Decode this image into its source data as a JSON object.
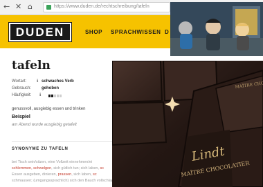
{
  "browser": {
    "url": "https://www.duden.de/rechtschreibung/tafeln",
    "back_icon": "arrow-left-icon",
    "close_icon": "close-icon",
    "home_icon": "home-icon",
    "lock_icon": "lock-icon"
  },
  "header": {
    "logo": "DUDEN",
    "nav": [
      "SHOP",
      "SPRACHWISSEN",
      "D"
    ],
    "brand_color": "#f6c200"
  },
  "entry": {
    "title": "tafeln",
    "wortart_label": "Wortart:",
    "wortart_value": "schwaches Verb",
    "gebrauch_label": "Gebrauch:",
    "gebrauch_value": "gehoben",
    "haeufigkeit_label": "Häufigkeit:",
    "frequency": 2,
    "frequency_max": 5,
    "definition": "genussvoll, ausgiebig essen und trinken",
    "beispiel_label": "Beispiel",
    "beispiel": "am Abend wurde ausgiebig getafelt"
  },
  "synonyms": {
    "title": "SYNONYME ZU TAFELN",
    "lines": [
      {
        "pre": "bei Tisch sein/sitzen, eine Vollzeit einnehmen/ei",
        "red": "",
        "post": ""
      },
      {
        "pre": "",
        "red": "schlemmen, schwelgen",
        "post": ", sich gütlich tun; sich laben, ",
        "red2": "sc"
      },
      {
        "pre": "Essen ausgeben, dinieren, ",
        "red": "prassen",
        "post": ", sich laben, ",
        "red2": "sc"
      },
      {
        "pre": "schmausen; ",
        "red": "",
        "post": "(umgangssprachlich) sich den Bauch vollschlagen"
      }
    ]
  },
  "video": {
    "description_icon": "cartoon-video-thumbnail"
  },
  "photo": {
    "brand": "Lindt",
    "subtitle": "MAÎTRE CHOCOLATIER",
    "subtitle_small": "MAÎTRE CHOC"
  }
}
